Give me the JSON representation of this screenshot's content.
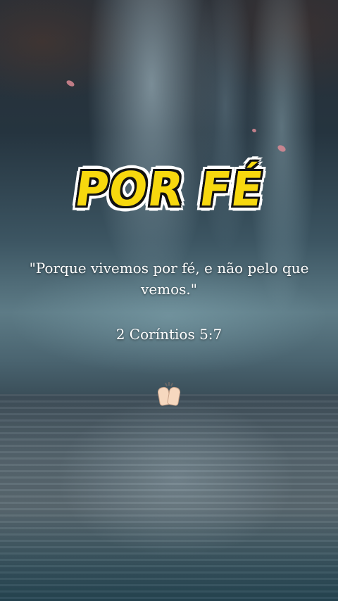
{
  "title": "POR FÉ",
  "quote": "\"Porque vivemos por fé, e não pelo que vemos.\"",
  "reference": "2 Coríntios 5:7",
  "emoji": "raised-hands-icon",
  "colors": {
    "title_fill": "#f7d80e",
    "title_outline": "#111111",
    "title_border": "#ffffff",
    "text": "#ffffff"
  }
}
